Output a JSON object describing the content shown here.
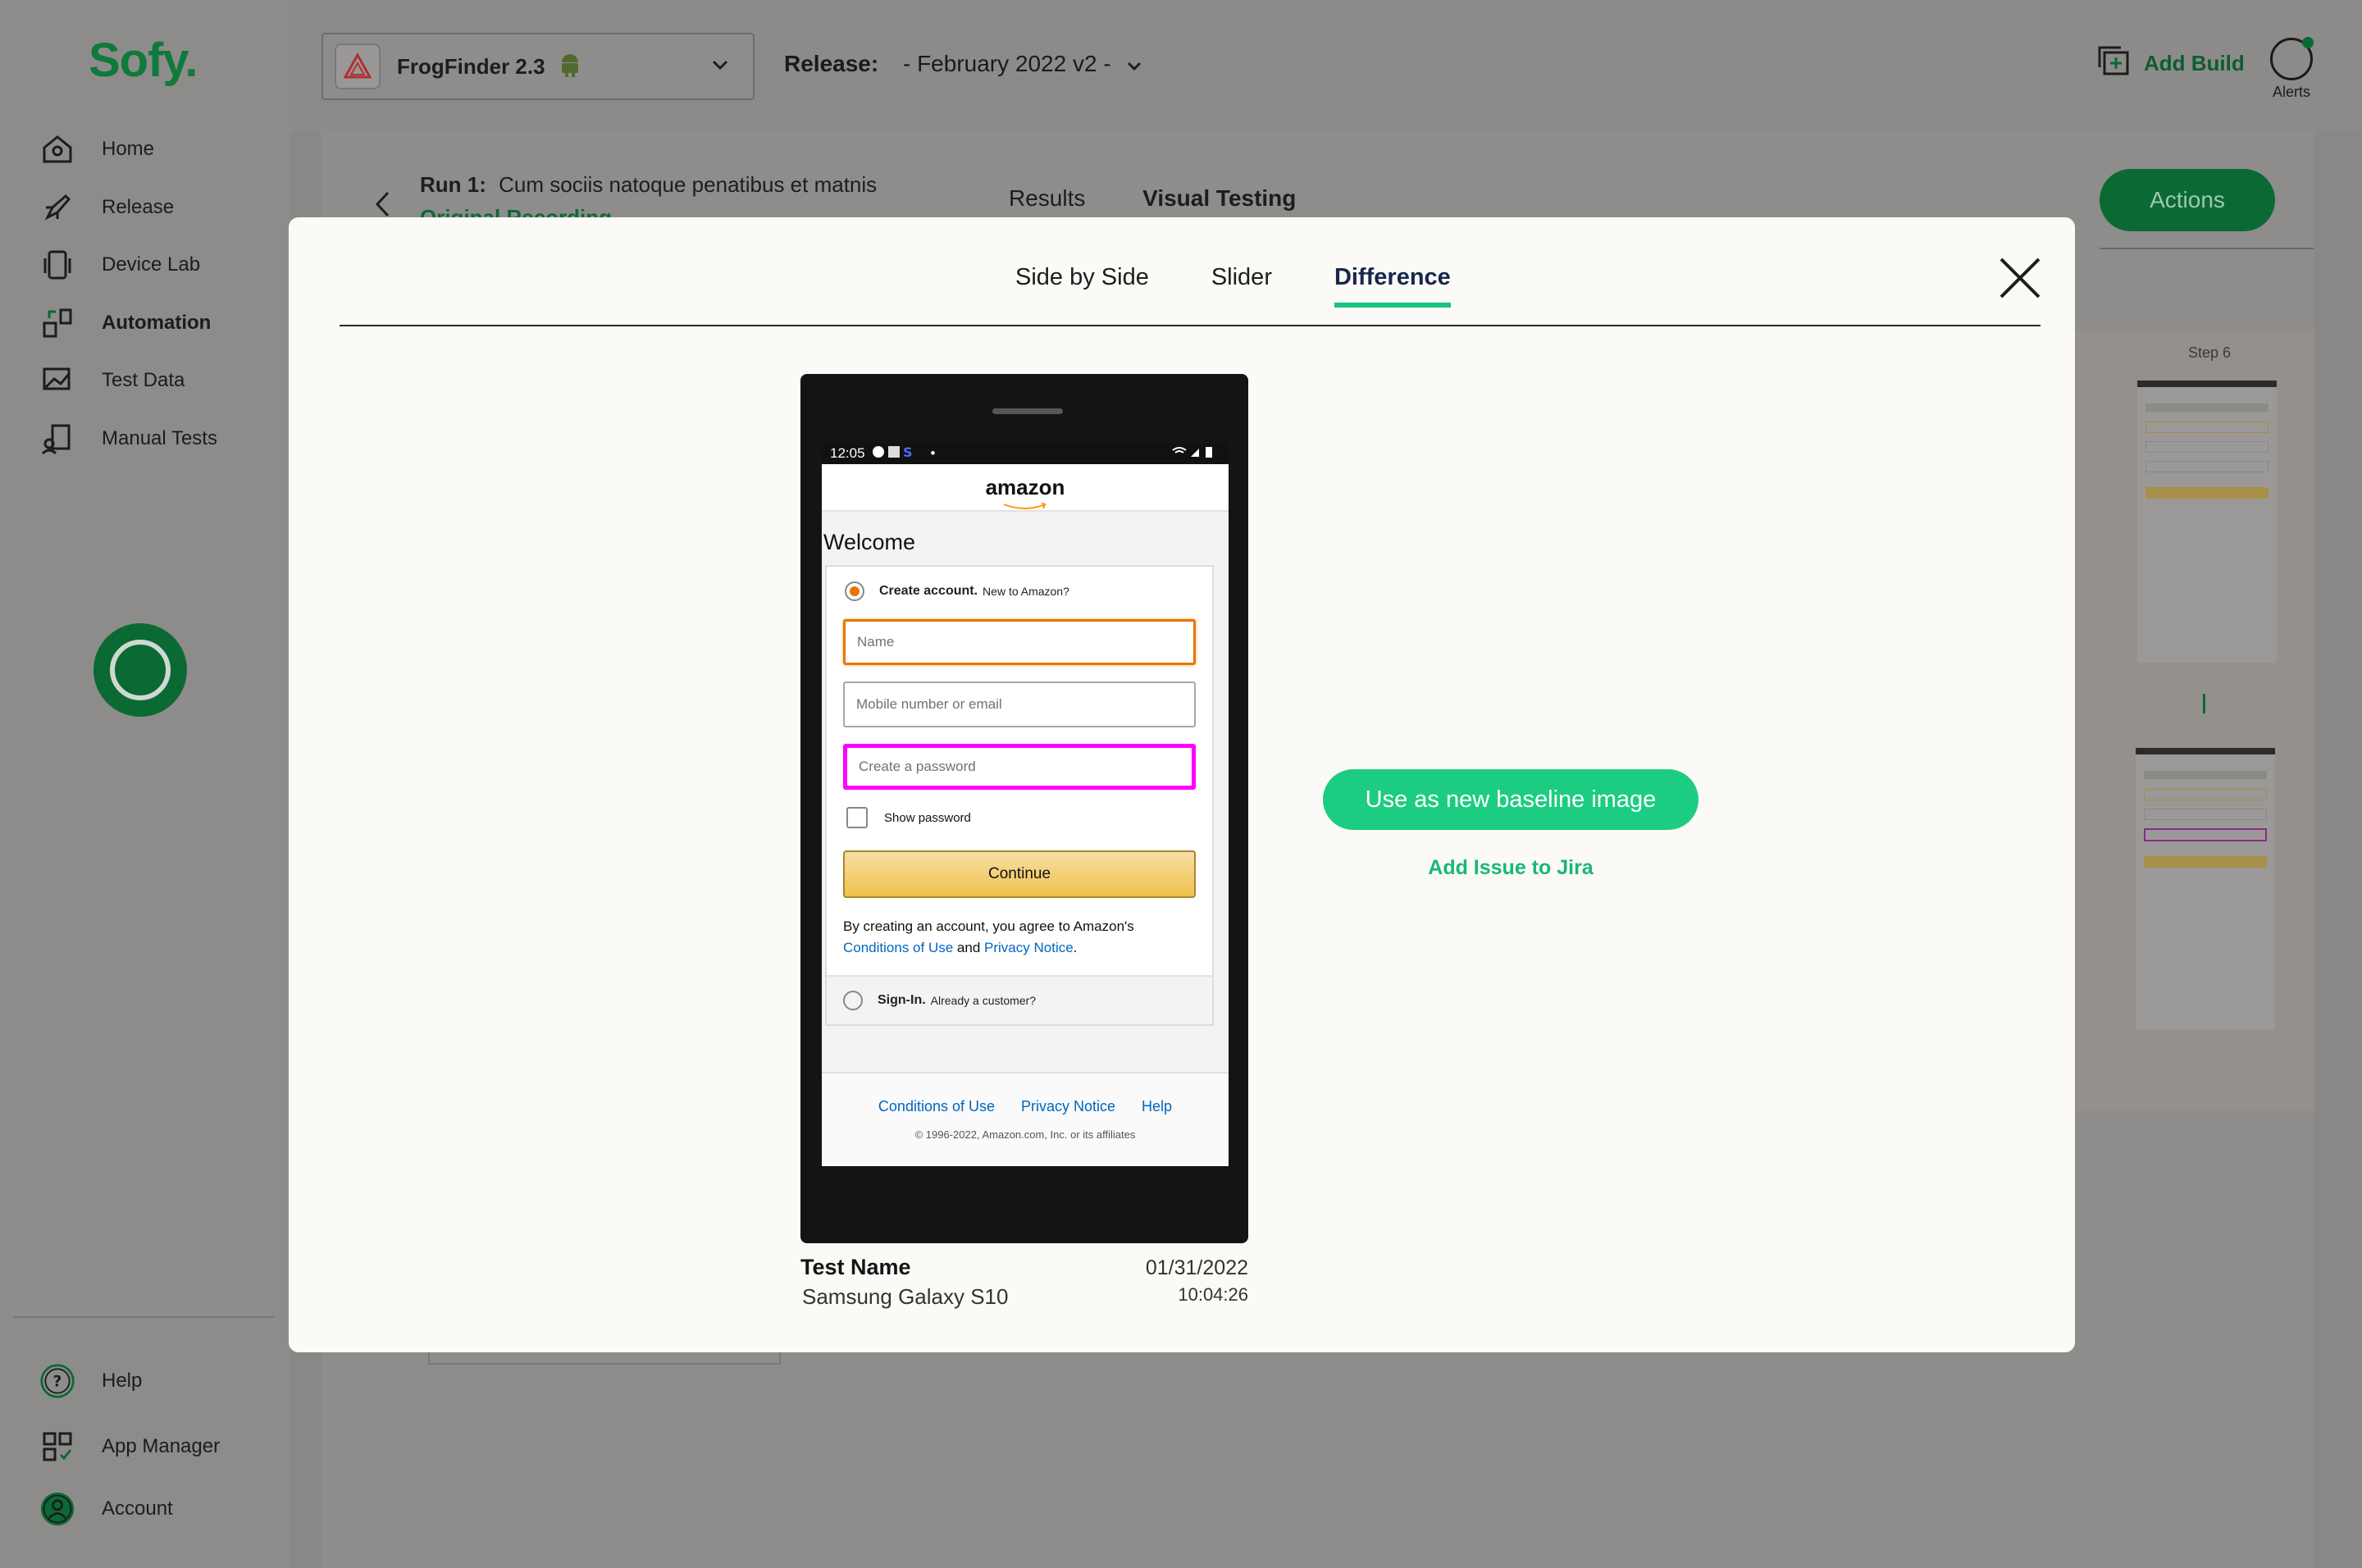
{
  "brand": {
    "logo": "Sofy."
  },
  "sidebar": {
    "items": [
      {
        "label": "Home",
        "icon": "home-icon"
      },
      {
        "label": "Release",
        "icon": "rocket-icon"
      },
      {
        "label": "Device Lab",
        "icon": "device-icon"
      },
      {
        "label": "Automation",
        "icon": "automation-icon"
      },
      {
        "label": "Test Data",
        "icon": "test-data-icon"
      },
      {
        "label": "Manual Tests",
        "icon": "manual-tests-icon"
      }
    ],
    "bottom_items": [
      {
        "label": "Help",
        "icon": "help-icon"
      },
      {
        "label": "App Manager",
        "icon": "app-manager-icon"
      },
      {
        "label": "Account",
        "icon": "account-icon"
      }
    ]
  },
  "header": {
    "app_name": "FrogFinder 2.3",
    "release_label": "Release:",
    "release_value": "- February 2022 v2 -",
    "add_build": "Add Build",
    "alerts": "Alerts"
  },
  "run": {
    "prefix": "Run 1:",
    "title": "Cum sociis natoque penatibus et matnis",
    "link": "Original Recording",
    "tabs": [
      "Results",
      "Visual Testing"
    ],
    "actions": "Actions",
    "step_label": "Step 6"
  },
  "modal": {
    "tabs": [
      "Side by Side",
      "Slider",
      "Difference"
    ],
    "active_tab": "Difference",
    "baseline_button": "Use as new baseline image",
    "jira_link": "Add Issue to Jira",
    "test_name": "Test Name",
    "device": "Samsung Galaxy S10",
    "date": "01/31/2022",
    "time": "10:04:26"
  },
  "screenshot": {
    "status_time": "12:05",
    "logo": "amazon",
    "welcome": "Welcome",
    "create_account": "Create account.",
    "create_account_sub": "New to Amazon?",
    "name_placeholder": "Name",
    "mobile_placeholder": "Mobile number or email",
    "password_placeholder": "Create a password",
    "show_password": "Show password",
    "continue": "Continue",
    "terms_text": "By creating an account, you agree to Amazon's",
    "conditions": "Conditions of Use",
    "and": "and",
    "privacy": "Privacy Notice",
    "signin": "Sign-In.",
    "signin_sub": "Already a customer?",
    "footer_links": [
      "Conditions of Use",
      "Privacy Notice",
      "Help"
    ],
    "copyright": "© 1996-2022, Amazon.com, Inc. or its affiliates"
  },
  "colors": {
    "accent": "#1dcc83",
    "brand_dark": "#0b6a34",
    "diff_highlight": "#ff00ff",
    "amazon_orange": "#e77600"
  }
}
